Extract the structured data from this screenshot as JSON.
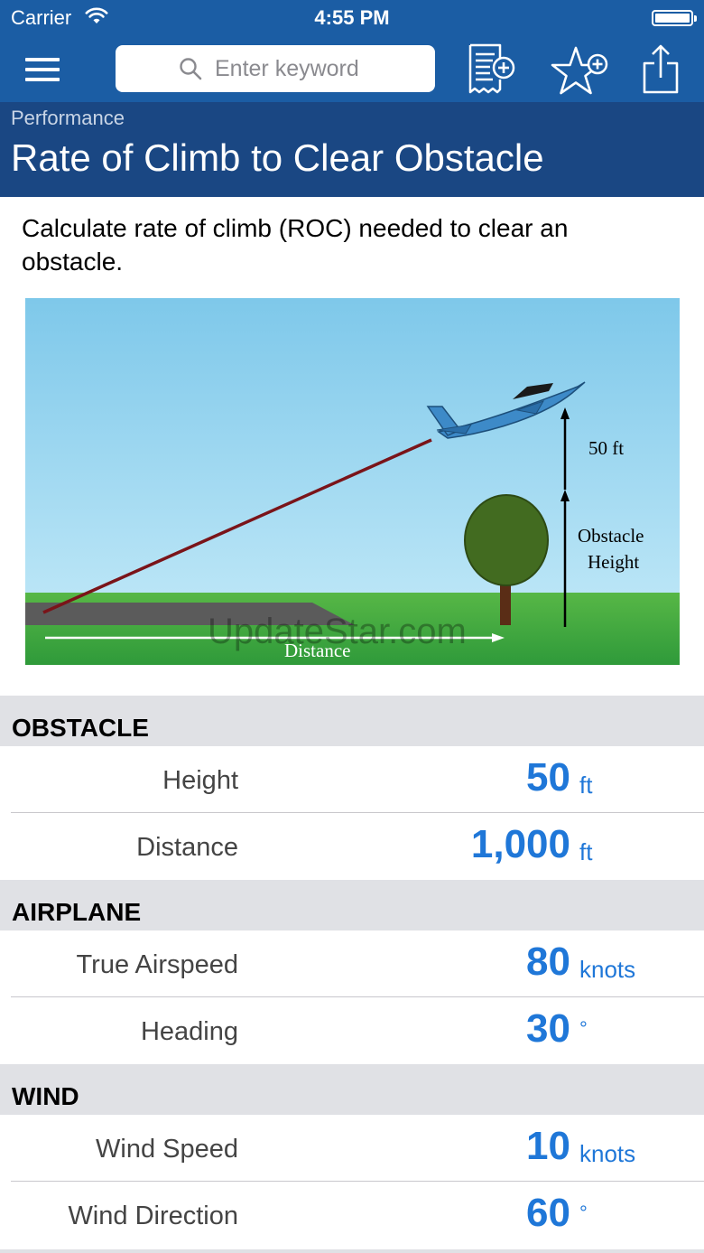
{
  "status_bar": {
    "carrier": "Carrier",
    "time": "4:55 PM"
  },
  "nav": {
    "search_placeholder": "Enter keyword"
  },
  "header": {
    "breadcrumb": "Performance",
    "title": "Rate of Climb to Clear Obstacle"
  },
  "description": "Calculate rate of climb (ROC) needed to clear an obstacle.",
  "diagram": {
    "label_50ft": "50 ft",
    "label_obstacle_line1": "Obstacle",
    "label_obstacle_line2": "Height",
    "label_distance": "Distance",
    "watermark": "UpdateStar.com"
  },
  "sections": {
    "obstacle": {
      "title": "OBSTACLE",
      "height": {
        "label": "Height",
        "value": "50",
        "unit": "ft"
      },
      "distance": {
        "label": "Distance",
        "value": "1,000",
        "unit": "ft"
      }
    },
    "airplane": {
      "title": "AIRPLANE",
      "true_airspeed": {
        "label": "True Airspeed",
        "value": "80",
        "unit": "knots"
      },
      "heading": {
        "label": "Heading",
        "value": "30",
        "unit": "°"
      }
    },
    "wind": {
      "title": "WIND",
      "wind_speed": {
        "label": "Wind Speed",
        "value": "10",
        "unit": "knots"
      },
      "wind_direction": {
        "label": "Wind Direction",
        "value": "60",
        "unit": "°"
      }
    }
  },
  "colors": {
    "nav_bar": "#1b5da4",
    "header_band": "#1a4783",
    "accent_value": "#1f77d8",
    "section_bg": "#e0e1e5"
  },
  "icons": [
    "menu-icon",
    "search-icon",
    "add-note-icon",
    "add-favorite-icon",
    "share-icon",
    "wifi-icon",
    "battery-icon"
  ]
}
